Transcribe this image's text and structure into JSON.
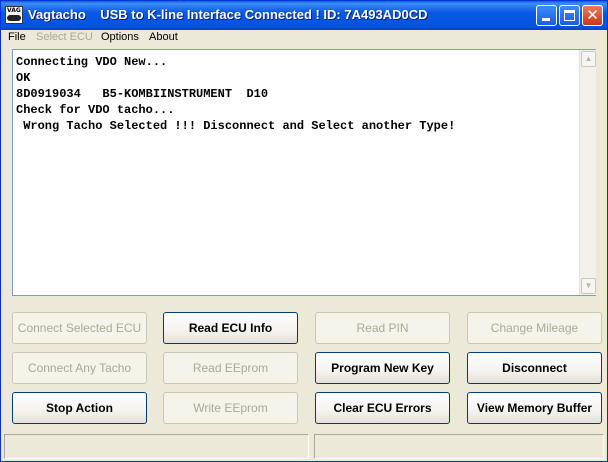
{
  "window": {
    "title": "Vagtacho    USB to K-line Interface Connected ! ID: 7A493AD0CD",
    "icon_text": "VAG"
  },
  "menu": [
    {
      "label": "File",
      "enabled": true
    },
    {
      "label": "Select ECU",
      "enabled": false
    },
    {
      "label": "Options",
      "enabled": true
    },
    {
      "label": "About",
      "enabled": true
    }
  ],
  "log": {
    "lines": [
      "Connecting VDO New...",
      "OK",
      "8D0919034   B5-KOMBIINSTRUMENT  D10",
      "Check for VDO tacho...",
      " Wrong Tacho Selected !!! Disconnect and Select another Type!"
    ]
  },
  "buttons": {
    "connect_selected_ecu": {
      "label": "Connect Selected ECU",
      "enabled": false
    },
    "read_ecu_info": {
      "label": "Read  ECU Info",
      "enabled": true
    },
    "read_pin": {
      "label": "Read PIN",
      "enabled": false
    },
    "change_mileage": {
      "label": "Change Mileage",
      "enabled": false
    },
    "connect_any_tacho": {
      "label": "Connect Any Tacho",
      "enabled": false
    },
    "read_eeprom": {
      "label": "Read EEprom",
      "enabled": false
    },
    "program_new_key": {
      "label": "Program New Key",
      "enabled": true
    },
    "disconnect": {
      "label": "Disconnect",
      "enabled": true
    },
    "stop_action": {
      "label": "Stop Action",
      "enabled": true
    },
    "write_eeprom": {
      "label": "Write EEprom",
      "enabled": false
    },
    "clear_ecu_errors": {
      "label": "Clear ECU Errors",
      "enabled": true
    },
    "view_memory_buffer": {
      "label": "View Memory Buffer",
      "enabled": true
    }
  },
  "statusbar": {
    "pane1": "",
    "pane2": ""
  },
  "colors": {
    "titlebar": "#0553e1",
    "window_bg": "#ece9d8",
    "disabled_text": "#aca899"
  }
}
